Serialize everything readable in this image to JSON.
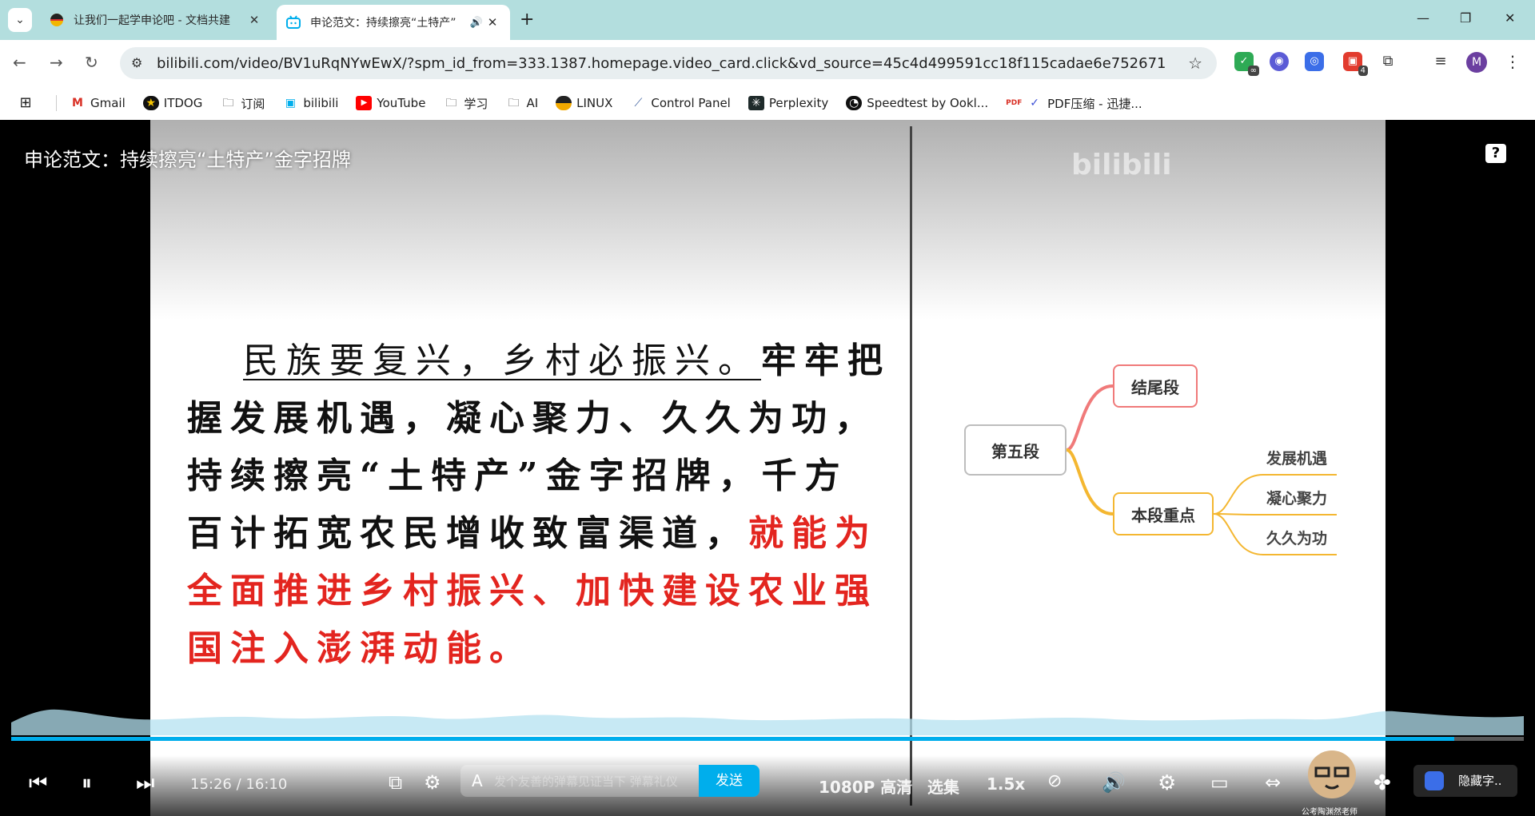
{
  "browser": {
    "tabs": [
      {
        "title": "让我们一起学申论吧 - 文档共建",
        "active": false
      },
      {
        "title": "申论范文：持续擦亮“土特产”",
        "active": true
      }
    ],
    "url": "bilibili.com/video/BV1uRqNYwEwX/?spm_id_from=333.1387.homepage.video_card.click&vd_source=45c4d499591cc18f115cadae6e752671",
    "avatar_letter": "M",
    "ext_badge_1": "∞",
    "ext_badge_2": "4",
    "bookmarks": [
      "Gmail",
      "ITDOG",
      "订阅",
      "bilibili",
      "YouTube",
      "学习",
      "AI",
      "LINUX",
      "Control Panel",
      "Perplexity",
      "Speedtest by Ookl...",
      "PDF压缩 - 迅捷..."
    ]
  },
  "video": {
    "title": "申论范文：持续擦亮“土特产”金字招牌",
    "essay": {
      "underlined": "民族要复兴，乡村必振兴。",
      "black": "牢牢把握发展机遇，凝心聚力、久久为功，持续擦亮“土特产”金字招牌，千方百计拓宽农民增收致富渠道，",
      "red": "就能为全面推进乡村振兴、加快建设农业强国注入澎湃动能。"
    },
    "mindmap": {
      "root": "第五段",
      "end": "结尾段",
      "focus": "本段重点",
      "leaves": [
        "发展机遇",
        "凝心聚力",
        "久久为功"
      ]
    },
    "watermark": "bilibili"
  },
  "player": {
    "time_current": "15:26",
    "time_sep": "/",
    "time_total": "16:10",
    "progress": 0.954,
    "danmaku_placeholder": "发个友善的弹幕见证当下  弹幕礼仪",
    "send_label": "发送",
    "quality": "1080P 高清",
    "episodes": "选集",
    "speed": "1.5x",
    "hide_subtitle": "隐藏字..",
    "mascot_caption": "公考陶渊然老师",
    "colors": {
      "accent": "#00aeec",
      "essay_red": "#e3251f"
    }
  }
}
